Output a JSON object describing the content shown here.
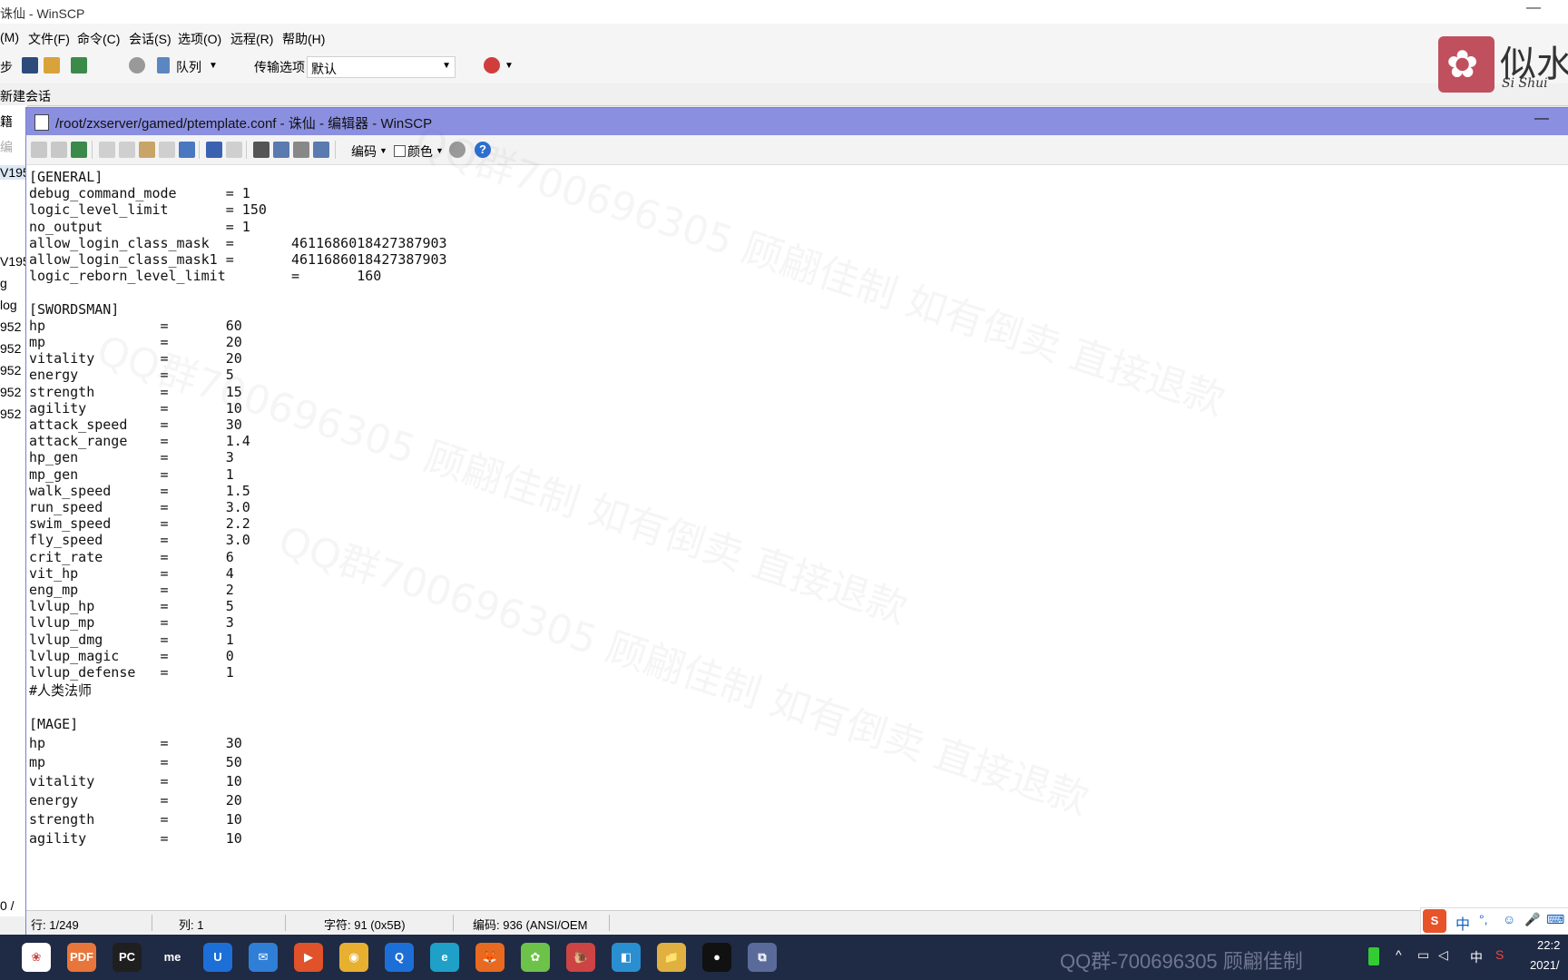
{
  "main_window": {
    "title": "诛仙 - WinSCP",
    "minimize": "—"
  },
  "menu": [
    "(M)",
    "文件(F)",
    "命令(C)",
    "会话(S)",
    "选项(O)",
    "远程(R)",
    "帮助(H)"
  ],
  "main_toolbar": {
    "sync_label": "步",
    "queue_label": "队列",
    "transfer_options_label": "传输选项",
    "transfer_preset": "默认"
  },
  "session_tab": "新建会话",
  "left_panel": [
    "籍",
    "编",
    "V195",
    "V195",
    "g",
    "log",
    "952",
    "952",
    "952",
    "952",
    "952",
    "0 /"
  ],
  "logo": {
    "cn": "似水",
    "en": "Si Shui",
    "flower": "✿"
  },
  "editor": {
    "title": "/root/zxserver/gamed/ptemplate.conf - 诛仙 - 编辑器 - WinSCP",
    "minimize": "—",
    "toolbar": {
      "encoding_label": "编码",
      "color_label": "颜色",
      "help": "?"
    },
    "lines": [
      "[GENERAL]",
      "debug_command_mode      = 1",
      "logic_level_limit       = 150",
      "no_output               = 1",
      "allow_login_class_mask  =       4611686018427387903",
      "allow_login_class_mask1 =       4611686018427387903",
      "logic_reborn_level_limit        =       160",
      "",
      "[SWORDSMAN]",
      "hp              =       60",
      "mp              =       20",
      "vitality        =       20",
      "energy          =       5",
      "strength        =       15",
      "agility         =       10",
      "attack_speed    =       30",
      "attack_range    =       1.4",
      "hp_gen          =       3",
      "mp_gen          =       1",
      "walk_speed      =       1.5",
      "run_speed       =       3.0",
      "swim_speed      =       2.2",
      "fly_speed       =       3.0",
      "crit_rate       =       6",
      "vit_hp          =       4",
      "eng_mp          =       2",
      "lvlup_hp        =       5",
      "lvlup_mp        =       3",
      "lvlup_dmg       =       1",
      "lvlup_magic     =       0",
      "lvlup_defense   =       1",
      "#人类法师",
      "",
      "[MAGE]",
      "hp              =       30",
      "mp              =       50",
      "vitality        =       10",
      "energy          =       20",
      "strength        =       10",
      "agility         =       10"
    ],
    "status": {
      "line": "行: 1/249",
      "column": "列: 1",
      "char": "字符: 91 (0x5B)",
      "encoding": "编码: 936  (ANSI/OEM"
    }
  },
  "watermark": [
    "QQ群700696305 顾翩佳制 如有倒卖 直接退款",
    "QQ群700696305 顾翩佳制 如有倒卖 直接退款",
    "QQ群700696305 顾翩佳制 如有倒卖 直接退款"
  ],
  "taskbar": {
    "apps": [
      "❀",
      "PDF",
      "PC",
      "me",
      "U",
      "✉",
      "▶",
      "◉",
      "Q",
      "e",
      "🦊",
      "✿",
      "🐌",
      "◧",
      "📁",
      "●",
      "⧉"
    ],
    "watermark_text": "QQ群-700696305 顾翩佳制",
    "tray": {
      "ime": "中",
      "time": "22:2",
      "date": "2021/"
    }
  },
  "colors": {
    "editor_title": "#8b8fe0",
    "taskbar": "#1f2a44",
    "logo": "#c0505e"
  }
}
